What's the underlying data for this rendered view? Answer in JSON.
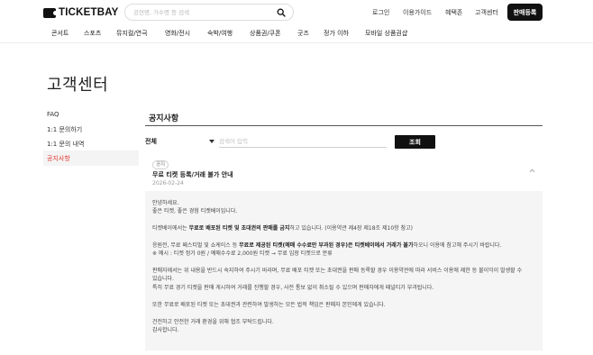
{
  "header": {
    "logo_text": "TICKETBAY",
    "search_placeholder": "공연명, 가수명 등 검색",
    "links": [
      "로그인",
      "이용가이드",
      "혜택존",
      "고객센터"
    ],
    "register_label": "판매등록"
  },
  "categories": [
    "콘서트",
    "스포츠",
    "뮤지컬/연극",
    "영화/전시",
    "숙박/여행",
    "상품권/쿠폰",
    "굿즈",
    "정가 이하",
    "모바일 상품권샵"
  ],
  "page_title": "고객센터",
  "sidebar": {
    "items": [
      "FAQ",
      "1:1 문의하기",
      "1:1 문의 내역",
      "공지사항"
    ],
    "active_index": 3
  },
  "section_title": "공지사항",
  "filter": {
    "select_value": "전체",
    "input_placeholder": "검색어 입력",
    "button_label": "조회"
  },
  "notice": {
    "badge": "공지",
    "title": "무료 티켓 등록/거래 불가 안내",
    "date": "2026-02-24",
    "body": {
      "greeting1": "안녕하세요.",
      "greeting2": "좋은 티켓, 좋은 경험 티켓베이입니다.",
      "p1_pre": "티켓베이에서는 ",
      "p1_bold": "무료로 배포된 티켓 및 초대권의 판매를 금지",
      "p1_post": "하고 있습니다. (이용약관 제4장 제18조 제10항 참고)",
      "p2_pre": "응원전, 무료 페스티벌 및 쇼케이스 등 ",
      "p2_bold1": "무료로 제공된 티켓(예매 수수료만 부과된 경우)은 티켓베이에서 거래가 불가",
      "p2_post": "하오니 이용에 참고해 주시기 바랍니다.",
      "p2_example": "※ 예시 : 티켓 정가 0원 / 예매수수료 2,000원 티켓 → 무료 입장 티켓으로 분류",
      "p3_line1": "판매자께서는 위 내용을 반드시 숙지하여 주시기 바라며, 무료 배포 티켓 또는 초대권을 판매 등록할 경우 이용약관에 따라 서비스 이용에 제한 등 불이익이 발생할 수",
      "p3_line2": "있습니다.",
      "p3_line3": "특히 무료 경기 티켓을 판매 게시하여 거래를 진행할 경우, 사전 통보 없이 취소될 수 있으며 판매자에게 패널티가 부과됩니다.",
      "p4": "또한 무료로 배포된 티켓 또는 초대권과 관련하여 발생하는 모든 법적 책임은 판매자 본인에게 있습니다.",
      "closing1": "건전하고 안전한 거래 환경을 위해 협조 부탁드립니다.",
      "closing2": "감사합니다."
    }
  }
}
